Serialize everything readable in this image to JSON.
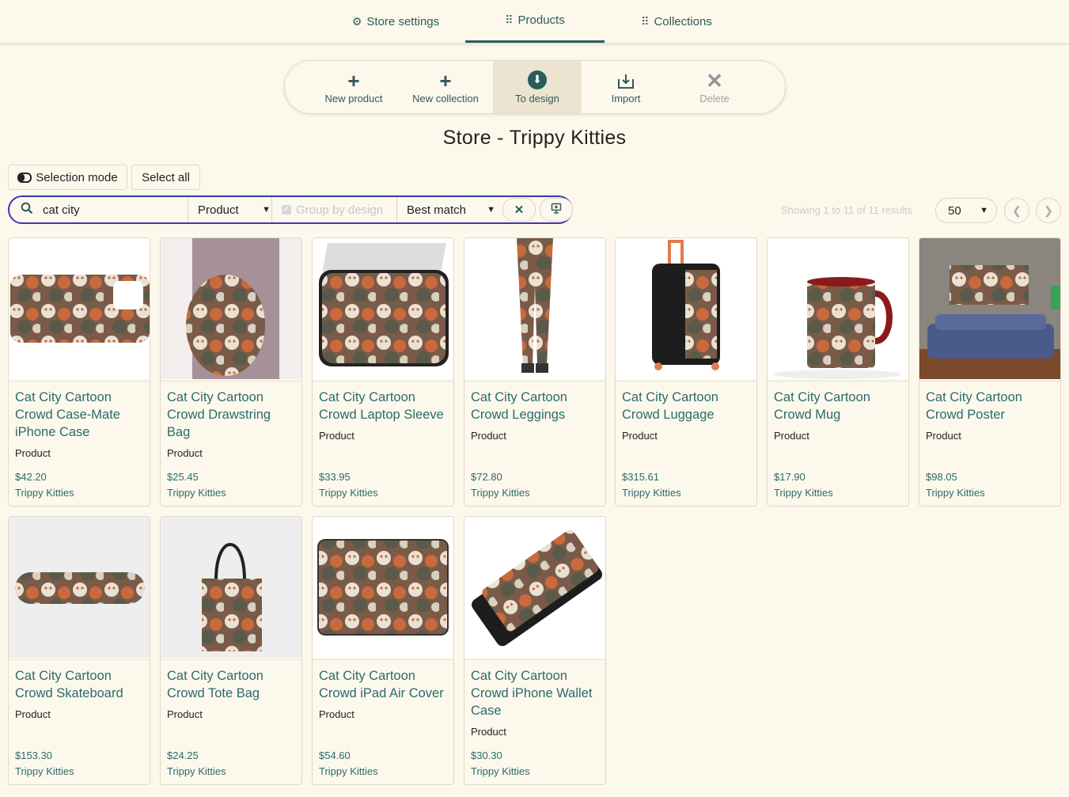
{
  "nav": {
    "tabs": [
      {
        "label": "Store settings",
        "icon": "gear-icon"
      },
      {
        "label": "Products",
        "icon": "grid-icon"
      },
      {
        "label": "Collections",
        "icon": "grid-icon"
      }
    ]
  },
  "toolbar": {
    "new_product": "New product",
    "new_collection": "New collection",
    "to_design": "To design",
    "import": "Import",
    "delete": "Delete"
  },
  "page_title": "Store - Trippy Kitties",
  "selection": {
    "selection_mode": "Selection mode",
    "select_all": "Select all"
  },
  "filters": {
    "search_value": "cat city",
    "type_select": "Product",
    "group_by_design": "Group by design",
    "sort_select": "Best match"
  },
  "results": {
    "showing": "Showing 1 to 11 of 11 results",
    "per_page": "50"
  },
  "products": [
    {
      "name": "Cat City Cartoon Crowd Case-Mate iPhone Case",
      "type": "Product",
      "price": "$42.20",
      "store": "Trippy Kitties"
    },
    {
      "name": "Cat City Cartoon Crowd Drawstring Bag",
      "type": "Product",
      "price": "$25.45",
      "store": "Trippy Kitties"
    },
    {
      "name": "Cat City Cartoon Crowd Laptop Sleeve",
      "type": "Product",
      "price": "$33.95",
      "store": "Trippy Kitties"
    },
    {
      "name": "Cat City Cartoon Crowd Leggings",
      "type": "Product",
      "price": "$72.80",
      "store": "Trippy Kitties"
    },
    {
      "name": "Cat City Cartoon Crowd Luggage",
      "type": "Product",
      "price": "$315.61",
      "store": "Trippy Kitties"
    },
    {
      "name": "Cat City Cartoon Crowd Mug",
      "type": "Product",
      "price": "$17.90",
      "store": "Trippy Kitties"
    },
    {
      "name": "Cat City Cartoon Crowd Poster",
      "type": "Product",
      "price": "$98.05",
      "store": "Trippy Kitties"
    },
    {
      "name": "Cat City Cartoon Crowd Skateboard",
      "type": "Product",
      "price": "$153.30",
      "store": "Trippy Kitties"
    },
    {
      "name": "Cat City Cartoon Crowd Tote Bag",
      "type": "Product",
      "price": "$24.25",
      "store": "Trippy Kitties"
    },
    {
      "name": "Cat City Cartoon Crowd iPad Air Cover",
      "type": "Product",
      "price": "$54.60",
      "store": "Trippy Kitties"
    },
    {
      "name": "Cat City Cartoon Crowd iPhone Wallet Case",
      "type": "Product",
      "price": "$30.30",
      "store": "Trippy Kitties"
    }
  ]
}
